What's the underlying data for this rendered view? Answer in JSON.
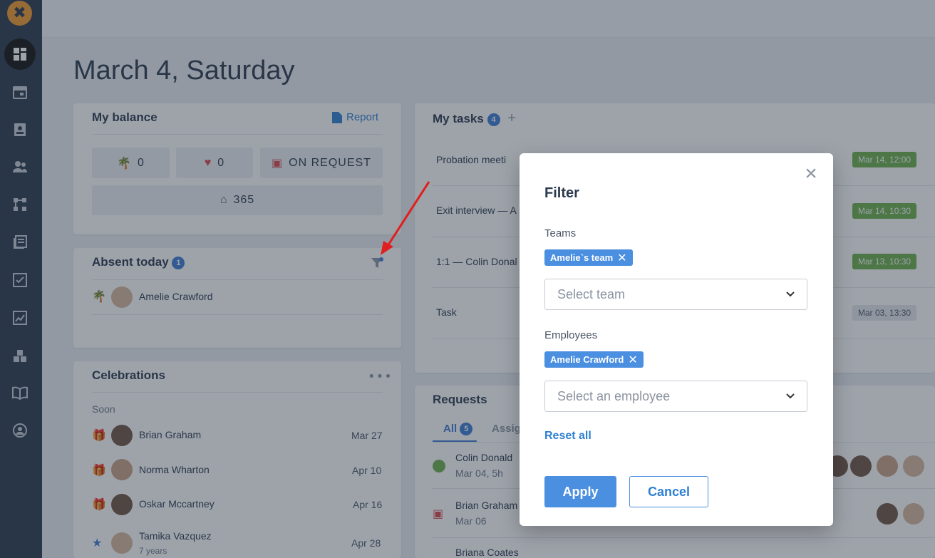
{
  "page": {
    "title": "March 4, Saturday"
  },
  "balance": {
    "title": "My balance",
    "report_label": "Report",
    "vacation": "0",
    "sick": "0",
    "on_request": "ON REQUEST",
    "home": "365"
  },
  "absent": {
    "title": "Absent today",
    "count": "1",
    "people": [
      {
        "name": "Amelie Crawford"
      }
    ]
  },
  "celebrations": {
    "title": "Celebrations",
    "section": "Soon",
    "items": [
      {
        "name": "Brian Graham",
        "date": "Mar 27"
      },
      {
        "name": "Norma Wharton",
        "date": "Apr 10"
      },
      {
        "name": "Oskar Mccartney",
        "date": "Apr 16"
      },
      {
        "name": "Tamika Vazquez",
        "sub": "7 years",
        "date": "Apr 28"
      }
    ]
  },
  "tasks": {
    "title": "My tasks",
    "count": "4",
    "items": [
      {
        "title": "Probation meeti",
        "date": "Mar 14, 12:00"
      },
      {
        "title": "Exit interview — A",
        "date": "Mar 14, 10:30"
      },
      {
        "title": "1:1 — Colin Donal",
        "date": "Mar 13, 10:30"
      },
      {
        "title": "Task",
        "date": "Mar 03, 13:30"
      }
    ]
  },
  "requests": {
    "title": "Requests",
    "tab_all": "All",
    "tab_all_count": "5",
    "tab_assigned": "Assig",
    "items": [
      {
        "name": "Colin Donald",
        "sub": "Mar 04, 5h"
      },
      {
        "name": "Brian Graham",
        "sub": "Mar 06"
      },
      {
        "name": "Briana Coates",
        "sub": ""
      }
    ]
  },
  "filter": {
    "title": "Filter",
    "teams_label": "Teams",
    "team_chip": "Amelie`s team",
    "team_placeholder": "Select team",
    "employees_label": "Employees",
    "employee_chip": "Amelie Crawford",
    "employee_placeholder": "Select an employee",
    "reset_label": "Reset all",
    "apply_label": "Apply",
    "cancel_label": "Cancel",
    "close_glyph": "×",
    "chip_remove_glyph": "✕"
  },
  "colors": {
    "accent": "#4a8fe0",
    "sidebar": "#2b3a4e",
    "green": "#6cb04a",
    "arrow": "#e02020"
  }
}
